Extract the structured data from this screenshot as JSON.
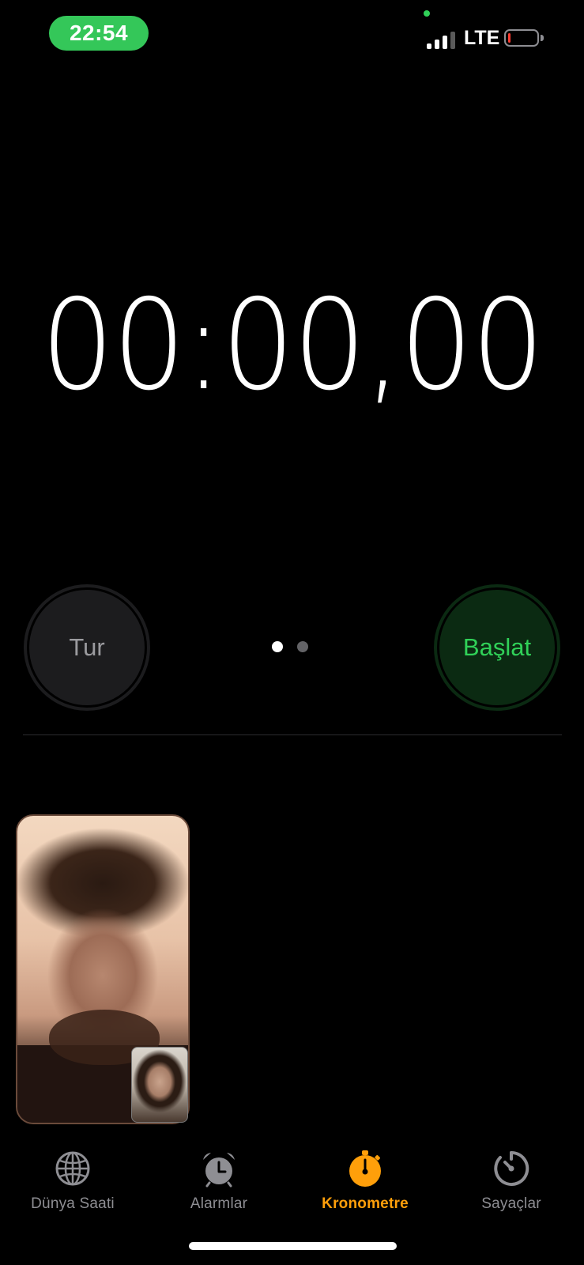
{
  "status_bar": {
    "time": "22:54",
    "network": "LTE",
    "battery_level": 0.1,
    "colors": {
      "time_pill": "#34c759",
      "battery_low": "#ff3b30"
    }
  },
  "stopwatch": {
    "display": "00:00,00"
  },
  "controls": {
    "lap_label": "Tur",
    "start_label": "Başlat",
    "page_count": 2,
    "active_page": 1,
    "colors": {
      "start_text": "#30d158",
      "lap_text": "#9b9b9f"
    }
  },
  "facetime": {
    "remote_video": "remote-participant",
    "local_video": "self-view"
  },
  "tab_bar": {
    "active_tab": "Kronometre",
    "accent_color": "#ff9f0a",
    "tabs": [
      {
        "label": "Dünya Saati",
        "icon": "globe-icon"
      },
      {
        "label": "Alarmlar",
        "icon": "alarm-clock-icon"
      },
      {
        "label": "Kronometre",
        "icon": "stopwatch-icon"
      },
      {
        "label": "Sayaçlar",
        "icon": "timer-icon"
      }
    ]
  }
}
